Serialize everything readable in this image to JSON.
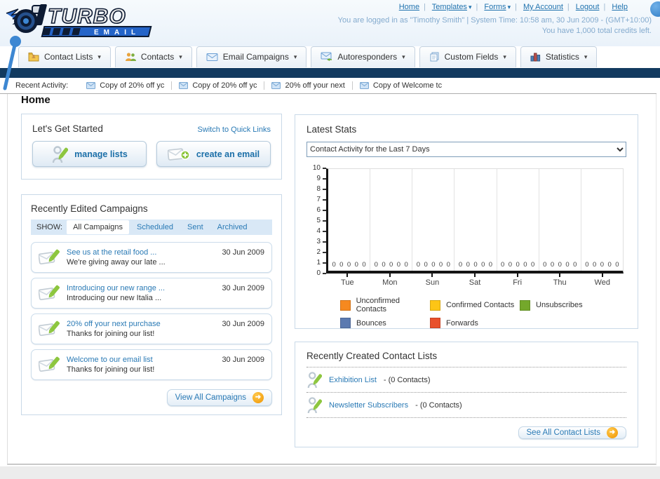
{
  "header": {
    "nav": [
      {
        "label": "Home"
      },
      {
        "label": "Templates",
        "dropdown": true
      },
      {
        "label": "Forms",
        "dropdown": true
      },
      {
        "label": "My Account"
      },
      {
        "label": "Logout"
      },
      {
        "label": "Help"
      }
    ],
    "login_info": "You are logged in as \"Timothy Smith\" | System Time: 10:58 am, 30 Jun 2009 - (GMT+10:00)",
    "credits_info": "You have 1,000 total credits left."
  },
  "tabs": [
    {
      "label": "Contact Lists",
      "icon": "contact-lists-folder-icon"
    },
    {
      "label": "Contacts",
      "icon": "contacts-people-icon"
    },
    {
      "label": "Email Campaigns",
      "icon": "envelope-icon"
    },
    {
      "label": "Autoresponders",
      "icon": "envelope-arrow-icon"
    },
    {
      "label": "Custom Fields",
      "icon": "pages-icon"
    },
    {
      "label": "Statistics",
      "icon": "bar-chart-icon"
    }
  ],
  "recent_activity": {
    "label": "Recent Activity:",
    "items": [
      {
        "text": "Copy of 20% off yc"
      },
      {
        "text": "Copy of 20% off yc"
      },
      {
        "text": "20% off your next "
      },
      {
        "text": "Copy of Welcome tc"
      }
    ]
  },
  "page_title": "Home",
  "get_started": {
    "title": "Let's Get Started",
    "switch_link": "Switch to Quick Links",
    "manage_lists_label": "manage lists",
    "create_email_label": "create an email"
  },
  "campaigns": {
    "title": "Recently Edited Campaigns",
    "show_label": "SHOW:",
    "filters": [
      {
        "label": "All Campaigns",
        "active": true
      },
      {
        "label": "Scheduled"
      },
      {
        "label": "Sent"
      },
      {
        "label": "Archived"
      }
    ],
    "items": [
      {
        "title": "See us at the retail food ...",
        "subtitle": "We're giving away our late ...",
        "date": "30 Jun 2009"
      },
      {
        "title": "Introducing our new range ...",
        "subtitle": "Introducing our new Italia ...",
        "date": "30 Jun 2009"
      },
      {
        "title": "20% off your next purchase",
        "subtitle": "Thanks for joining our list!",
        "date": "30 Jun 2009"
      },
      {
        "title": "Welcome to our email list",
        "subtitle": "Thanks for joining our list!",
        "date": "30 Jun 2009"
      }
    ],
    "view_all_label": "View All Campaigns"
  },
  "stats": {
    "title": "Latest Stats",
    "selected_option": "Contact Activity for the Last 7 Days"
  },
  "chart_data": {
    "type": "bar",
    "title": "Contact Activity for the Last 7 Days",
    "categories": [
      "Tue",
      "Mon",
      "Sun",
      "Sat",
      "Fri",
      "Thu",
      "Wed"
    ],
    "series": [
      {
        "name": "Unconfirmed Contacts",
        "color": "#f6891f",
        "values": [
          0,
          0,
          0,
          0,
          0,
          0,
          0
        ]
      },
      {
        "name": "Confirmed Contacts",
        "color": "#fdc516",
        "values": [
          0,
          0,
          0,
          0,
          0,
          0,
          0
        ]
      },
      {
        "name": "Unsubscribes",
        "color": "#74a82b",
        "values": [
          0,
          0,
          0,
          0,
          0,
          0,
          0
        ]
      },
      {
        "name": "Bounces",
        "color": "#5b7ab0",
        "values": [
          0,
          0,
          0,
          0,
          0,
          0,
          0
        ]
      },
      {
        "name": "Forwards",
        "color": "#e8502d",
        "values": [
          0,
          0,
          0,
          0,
          0,
          0,
          0
        ]
      }
    ],
    "ylim": [
      0,
      10
    ],
    "yticks": [
      0,
      1,
      2,
      3,
      4,
      5,
      6,
      7,
      8,
      9,
      10
    ],
    "grid": true,
    "legend_position": "bottom"
  },
  "contact_lists": {
    "title": "Recently Created Contact Lists",
    "items": [
      {
        "name": "Exhibition List",
        "detail": "- (0 Contacts)"
      },
      {
        "name": "Newsletter Subscribers",
        "detail": "- (0 Contacts)"
      }
    ],
    "see_all_label": "See All Contact Lists"
  },
  "icons": {
    "caret": "▾",
    "arrow": "➜"
  },
  "colors": {
    "navy_bar": "#123a5f",
    "link_blue": "#2a7ab5",
    "accent_orange": "#ef9400"
  }
}
